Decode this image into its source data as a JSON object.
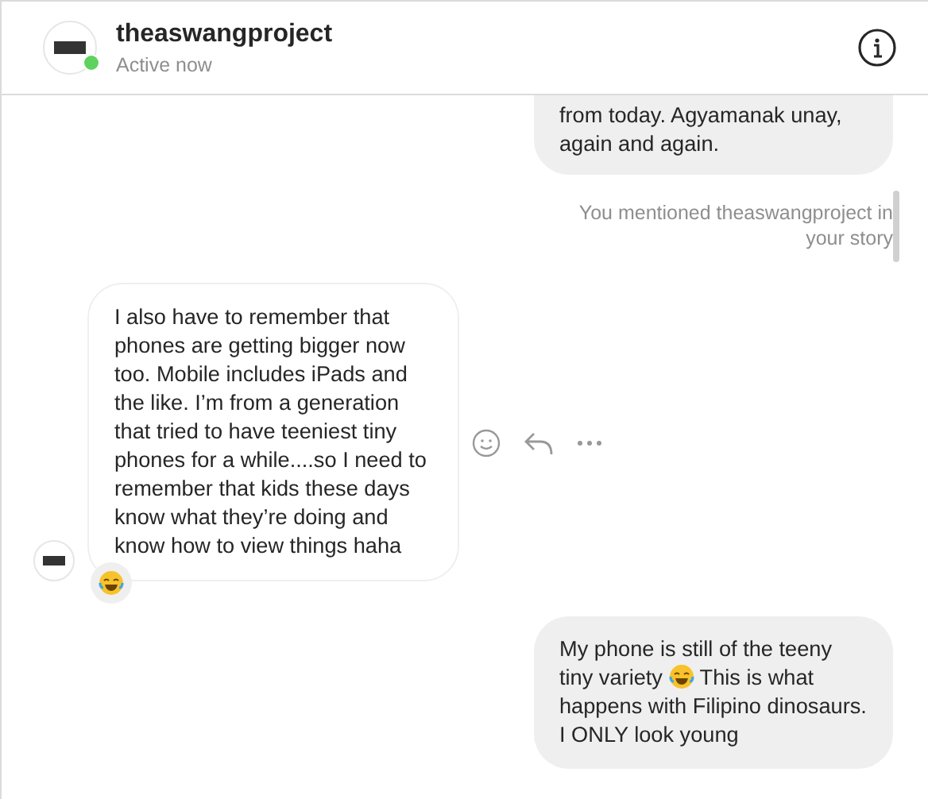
{
  "header": {
    "name": "theaswangproject",
    "status": "Active now",
    "online": true
  },
  "messages": [
    {
      "kind": "sent",
      "parts": [
        {
          "kind": "text",
          "text": "from today. Agyamanak unay, again and again."
        }
      ],
      "cut_top": true
    },
    {
      "kind": "notice",
      "text": "You mentioned theaswangproject in your story"
    },
    {
      "kind": "received",
      "parts": [
        {
          "kind": "text",
          "text": "I also have to remember that phones are getting bigger now too. Mobile includes iPads and the like. I’m from a generation that tried to have teeniest tiny phones for a while....so I need to remember that kids these days know what they’re doing and know how to view things haha"
        }
      ],
      "reacted": true,
      "hovered": true
    },
    {
      "kind": "sent",
      "parts": [
        {
          "kind": "text",
          "text": "My phone is still of the teeny tiny variety "
        },
        {
          "kind": "emoji"
        },
        {
          "kind": "text",
          "text": " This is what happens with Filipino dinosaurs. I ONLY look young"
        }
      ]
    }
  ]
}
